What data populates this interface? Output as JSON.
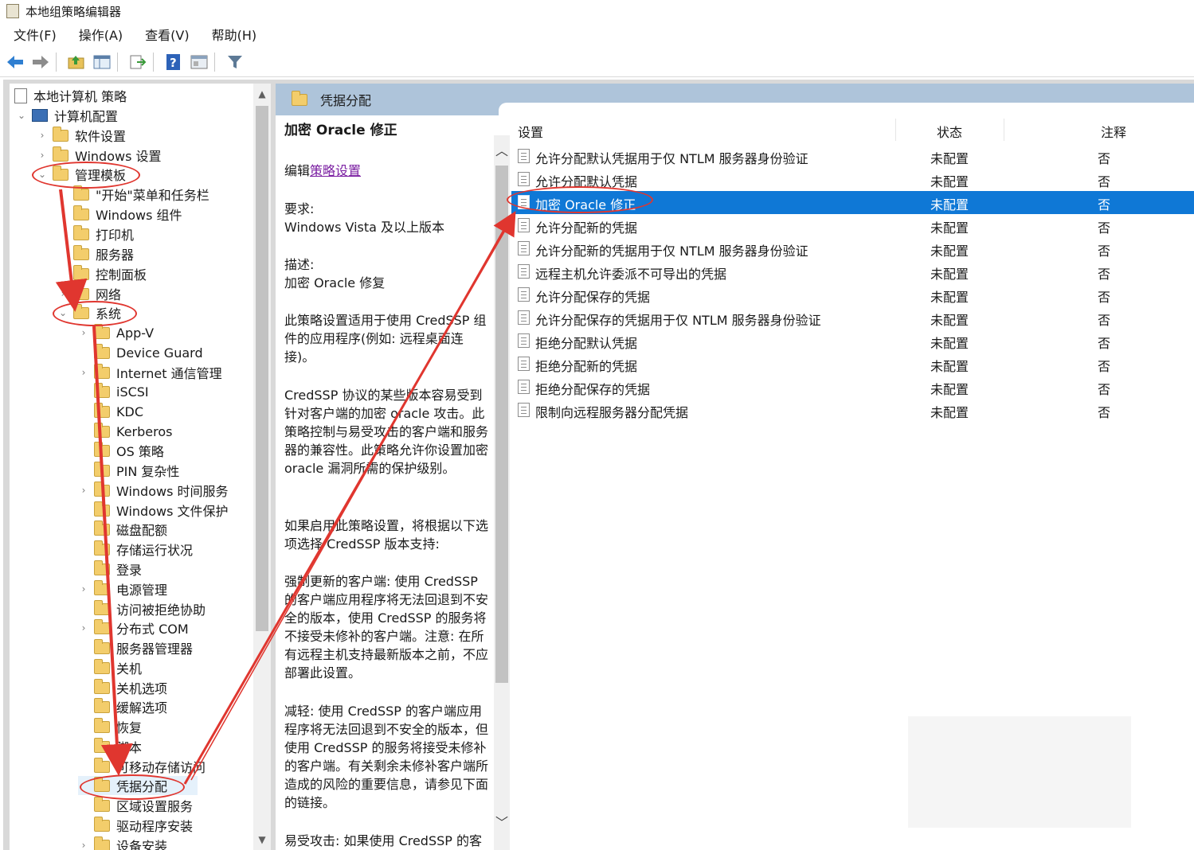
{
  "window": {
    "title": "本地组策略编辑器"
  },
  "menu": [
    "文件(F)",
    "操作(A)",
    "查看(V)",
    "帮助(H)"
  ],
  "toolbar": {
    "icons": [
      "back-arrow-icon",
      "forward-arrow-icon",
      "up-folder-icon",
      "show-hide-tree-icon",
      "export-list-icon",
      "help-icon",
      "properties-icon",
      "filter-icon"
    ]
  },
  "tree": {
    "root": "本地计算机 策略",
    "computer_config": "计算机配置",
    "software_settings": "软件设置",
    "windows_settings": "Windows 设置",
    "admin_templates": "管理模板",
    "admin_children": [
      "\"开始\"菜单和任务栏",
      "Windows 组件",
      "打印机",
      "服务器",
      "控制面板",
      "网络",
      "系统"
    ],
    "system_children": [
      "App-V",
      "Device Guard",
      "Internet 通信管理",
      "iSCSI",
      "KDC",
      "Kerberos",
      "OS 策略",
      "PIN 复杂性",
      "Windows 时间服务",
      "Windows 文件保护",
      "磁盘配额",
      "存储运行状况",
      "登录",
      "电源管理",
      "访问被拒绝协助",
      "分布式 COM",
      "服务器管理器",
      "关机",
      "关机选项",
      "缓解选项",
      "恢复",
      "脚本",
      "可移动存储访问",
      "凭据分配",
      "区域设置服务",
      "驱动程序安装",
      "设备安装"
    ]
  },
  "panel": {
    "header": "凭据分配",
    "desc_title": "加密 Oracle 修正",
    "edit_prefix": "编辑",
    "edit_link": "策略设置",
    "req_label": "要求:",
    "req_value": "Windows Vista 及以上版本",
    "desc_label": "描述:",
    "desc_value": "加密 Oracle 修复",
    "para1": "此策略设置适用于使用 CredSSP 组件的应用程序(例如: 远程桌面连接)。",
    "para2": "CredSSP 协议的某些版本容易受到针对客户端的加密 oracle 攻击。此策略控制与易受攻击的客户端和服务器的兼容性。此策略允许你设置加密 oracle 漏洞所需的保护级别。",
    "para3": "如果启用此策略设置，将根据以下选项选择 CredSSP 版本支持:",
    "para4": "强制更新的客户端: 使用 CredSSP 的客户端应用程序将无法回退到不安全的版本，使用 CredSSP 的服务将不接受未修补的客户端。注意: 在所有远程主机支持最新版本之前，不应部署此设置。",
    "para5": "减轻: 使用 CredSSP 的客户端应用程序将无法回退到不安全的版本，但使用 CredSSP 的服务将接受未修补的客户端。有关剩余未修补客户端所造成的风险的重要信息，请参见下面的链接。",
    "para6": "易受攻击: 如果使用 CredSSP 的客"
  },
  "list": {
    "columns": {
      "setting": "设置",
      "state": "状态",
      "comment": "注释"
    },
    "rows": [
      {
        "name": "允许分配默认凭据用于仅 NTLM 服务器身份验证",
        "state": "未配置",
        "comment": "否"
      },
      {
        "name": "允许分配默认凭据",
        "state": "未配置",
        "comment": "否"
      },
      {
        "name": "加密 Oracle 修正",
        "state": "未配置",
        "comment": "否"
      },
      {
        "name": "允许分配新的凭据",
        "state": "未配置",
        "comment": "否"
      },
      {
        "name": "允许分配新的凭据用于仅 NTLM 服务器身份验证",
        "state": "未配置",
        "comment": "否"
      },
      {
        "name": "远程主机允许委派不可导出的凭据",
        "state": "未配置",
        "comment": "否"
      },
      {
        "name": "允许分配保存的凭据",
        "state": "未配置",
        "comment": "否"
      },
      {
        "name": "允许分配保存的凭据用于仅 NTLM 服务器身份验证",
        "state": "未配置",
        "comment": "否"
      },
      {
        "name": "拒绝分配默认凭据",
        "state": "未配置",
        "comment": "否"
      },
      {
        "name": "拒绝分配新的凭据",
        "state": "未配置",
        "comment": "否"
      },
      {
        "name": "拒绝分配保存的凭据",
        "state": "未配置",
        "comment": "否"
      },
      {
        "name": "限制向远程服务器分配凭据",
        "state": "未配置",
        "comment": "否"
      }
    ]
  },
  "colors": {
    "selected_row": "#0f78d6",
    "header_bar": "#aec4da",
    "annotation": "#e0362f"
  }
}
